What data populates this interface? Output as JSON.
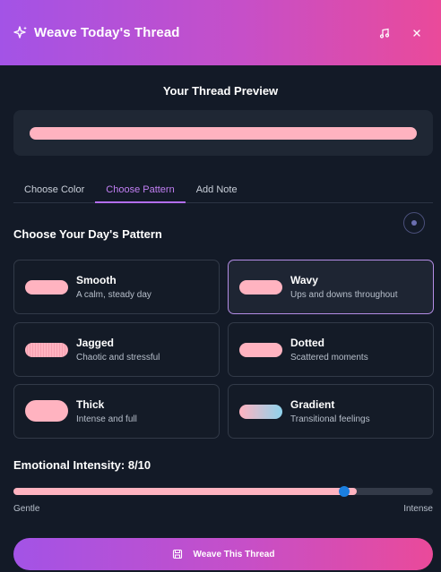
{
  "header": {
    "title": "Weave Today's Thread",
    "icons": {
      "leading": "sparkles-icon",
      "music": "music-note-icon",
      "close": "close-icon"
    }
  },
  "preview": {
    "title": "Your Thread Preview",
    "thread_color": "#ffb3c0"
  },
  "tabs": [
    {
      "label": "Choose Color",
      "active": false
    },
    {
      "label": "Choose Pattern",
      "active": true
    },
    {
      "label": "Add Note",
      "active": false
    }
  ],
  "pattern_section": {
    "title": "Choose Your Day's Pattern",
    "options": [
      {
        "name": "Smooth",
        "description": "A calm, steady day",
        "selected": false
      },
      {
        "name": "Wavy",
        "description": "Ups and downs throughout",
        "selected": true
      },
      {
        "name": "Jagged",
        "description": "Chaotic and stressful",
        "selected": false
      },
      {
        "name": "Dotted",
        "description": "Scattered moments",
        "selected": false
      },
      {
        "name": "Thick",
        "description": "Intense and full",
        "selected": false
      },
      {
        "name": "Gradient",
        "description": "Transitional feelings",
        "selected": false
      }
    ]
  },
  "intensity": {
    "label": "Emotional Intensity: 8/10",
    "value": 8,
    "max": 10,
    "min_label": "Gentle",
    "max_label": "Intense"
  },
  "action": {
    "label": "Weave This Thread",
    "icon": "save-icon"
  },
  "colors": {
    "accent_start": "#a353e6",
    "accent_end": "#ea4a9a",
    "thread_pink": "#ffb3c0",
    "slider_thumb": "#1b7fe0",
    "background": "#131a27"
  }
}
